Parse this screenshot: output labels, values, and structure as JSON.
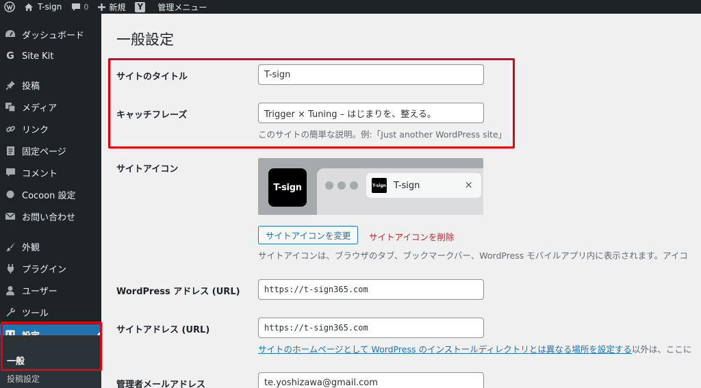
{
  "adminbar": {
    "site_name": "T-sign",
    "comment_count": "0",
    "new_label": "新規",
    "yoast_letter": "Y",
    "admin_menu_label": "管理メニュー"
  },
  "sidebar": {
    "items": [
      {
        "label": "ダッシュボード",
        "icon": "dashboard-icon"
      },
      {
        "label": "Site Kit",
        "icon": "site-kit-icon"
      },
      {
        "label": "投稿",
        "icon": "pin-icon"
      },
      {
        "label": "メディア",
        "icon": "media-icon"
      },
      {
        "label": "リンク",
        "icon": "link-icon"
      },
      {
        "label": "固定ページ",
        "icon": "page-icon"
      },
      {
        "label": "コメント",
        "icon": "comment-icon"
      },
      {
        "label": "Cocoon 設定",
        "icon": "circle-icon"
      },
      {
        "label": "お問い合わせ",
        "icon": "mail-icon"
      },
      {
        "label": "外観",
        "icon": "brush-icon"
      },
      {
        "label": "プラグイン",
        "icon": "plugin-icon"
      },
      {
        "label": "ユーザー",
        "icon": "user-icon"
      },
      {
        "label": "ツール",
        "icon": "wrench-icon"
      },
      {
        "label": "設定",
        "icon": "settings-icon"
      }
    ],
    "submenu": {
      "current": "一般",
      "next": "投稿設定"
    }
  },
  "main": {
    "page_title": "一般設定",
    "site_title": {
      "label": "サイトのタイトル",
      "value": "T-sign"
    },
    "tagline": {
      "label": "キャッチフレーズ",
      "value": "Trigger × Tuning – はじまりを、整える。",
      "description": "このサイトの簡単な説明。例:「Just another WordPress site」"
    },
    "site_icon": {
      "label": "サイトアイコン",
      "icon_text": "T-sign",
      "tab_title": "T-sign",
      "tab_close": "×",
      "change_button": "サイトアイコンを変更",
      "remove_link": "サイトアイコンを削除",
      "description": "サイトアイコンは、ブラウザのタブ、ブックマークバー、WordPress モバイルアプリ内に表示されます。アイコ"
    },
    "wp_address": {
      "label": "WordPress アドレス (URL)",
      "value": "https://t-sign365.com"
    },
    "site_address": {
      "label": "サイトアドレス (URL)",
      "value": "https://t-sign365.com",
      "description_link": "サイトのホームページとして WordPress のインストールディレクトリとは異なる場所を設定する",
      "description_rest": "以外は、ここに"
    },
    "admin_email": {
      "label": "管理者メールアドレス",
      "value": "te.yoshizawa@gmail.com"
    }
  },
  "colors": {
    "admin_dark": "#1d2327",
    "accent_blue": "#2271b1",
    "highlight_red": "#e50012",
    "delete_red": "#b32d2e"
  }
}
